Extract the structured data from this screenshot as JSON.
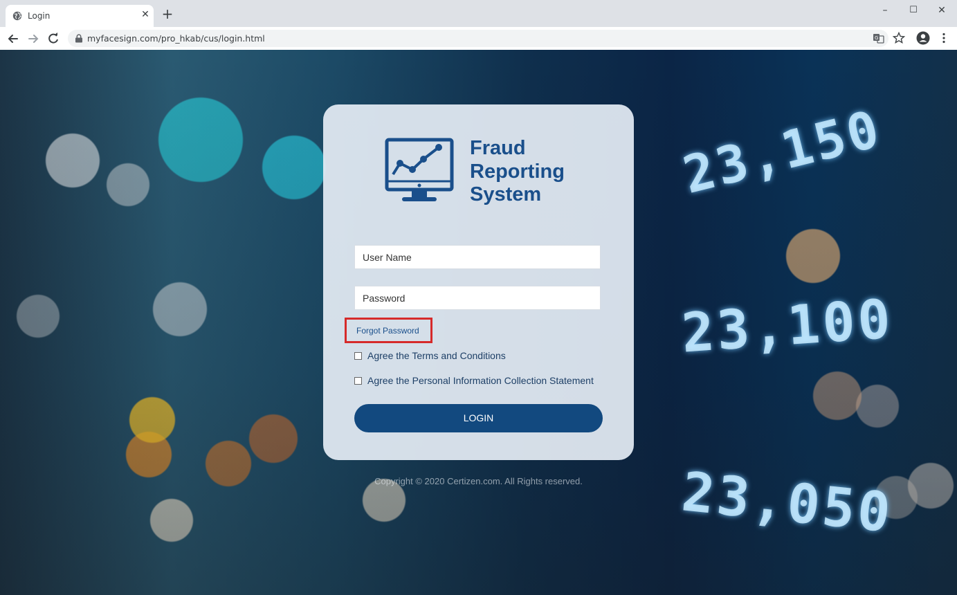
{
  "browser": {
    "tab_title": "Login",
    "tab_close": "✕",
    "new_tab": "+",
    "url": "myfacesign.com/pro_hkab/cus/login.html",
    "window_controls": {
      "minimize": "–",
      "maximize": "☐",
      "close": "✕"
    },
    "icons": [
      "globe-icon",
      "back-icon",
      "forward-icon",
      "reload-icon",
      "lock-icon",
      "translate-icon",
      "star-icon",
      "profile-icon",
      "menu-icon"
    ]
  },
  "login": {
    "logo_line1": "Fraud",
    "logo_line2": "Reporting",
    "logo_line3": "System",
    "username_placeholder": "User Name",
    "password_placeholder": "Password",
    "forgot_password": "Forgot Password",
    "agree_terms": "Agree the Terms and Conditions",
    "agree_pics": "Agree the Personal Information Collection Statement",
    "login_button": "LOGIN"
  },
  "footer": {
    "copyright": "Copyright © 2020 Certizen.com. All Rights reserved."
  },
  "background": {
    "tickers": [
      "23,150",
      "23,100",
      "23,050"
    ]
  },
  "colors": {
    "brand": "#1a4f8b",
    "button": "#12497f",
    "highlight": "#d62a2a"
  }
}
